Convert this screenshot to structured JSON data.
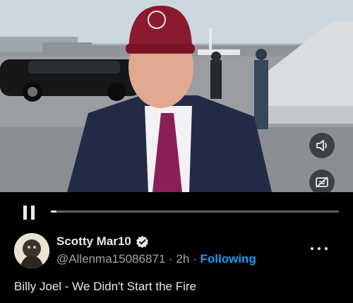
{
  "post": {
    "display_name": "Scotty Mar10",
    "handle": "@Allenma15086871",
    "separator": "·",
    "time": "2h",
    "follow_status": "Following",
    "caption": "Billy Joel - We Didn't Start the Fire"
  },
  "video": {
    "progress": 0.02
  },
  "icons": {
    "verified": "verified-badge-icon",
    "volume": "volume-icon",
    "captions": "captions-off-icon",
    "pause": "pause-icon",
    "more": "more-options-icon"
  },
  "colors": {
    "accent": "#1d9bf0",
    "background": "#000000",
    "text": "#e7e9ea",
    "muted": "#9ea4aa"
  }
}
